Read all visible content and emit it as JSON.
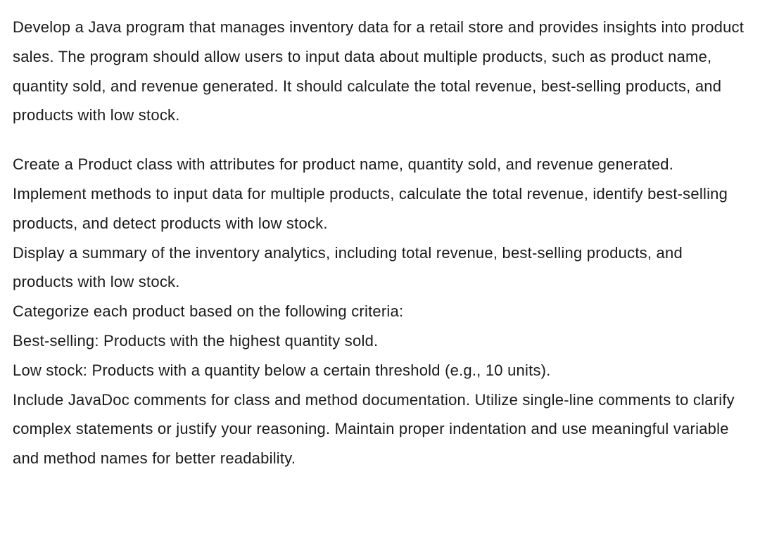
{
  "paragraph1": "Develop a Java program that manages inventory data for a retail store and provides insights into product sales. The program should allow users to input data about multiple products, such as product name, quantity sold, and revenue generated. It should calculate the total revenue, best-selling products, and products with low stock.",
  "paragraph2_lines": [
    "Create a Product class with attributes for product name, quantity sold, and revenue generated.",
    "Implement methods to input data for multiple products, calculate the total revenue, identify best-selling products, and detect products with low stock.",
    "Display a summary of the inventory analytics, including total revenue, best-selling products, and products with low stock.",
    "Categorize each product based on the following criteria:",
    "Best-selling: Products with the highest quantity sold.",
    "Low stock: Products with a quantity below a certain threshold (e.g., 10 units).",
    "Include JavaDoc comments for class and method documentation. Utilize single-line comments to clarify complex statements or justify your reasoning. Maintain proper indentation and use meaningful variable and method names for better readability."
  ]
}
